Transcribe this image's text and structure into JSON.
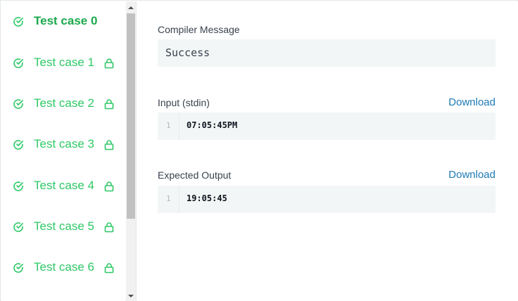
{
  "test_cases": [
    {
      "label": "Test case 0",
      "status": "passed",
      "locked": false,
      "active": true
    },
    {
      "label": "Test case 1",
      "status": "passed",
      "locked": true,
      "active": false
    },
    {
      "label": "Test case 2",
      "status": "passed",
      "locked": true,
      "active": false
    },
    {
      "label": "Test case 3",
      "status": "passed",
      "locked": true,
      "active": false
    },
    {
      "label": "Test case 4",
      "status": "passed",
      "locked": true,
      "active": false
    },
    {
      "label": "Test case 5",
      "status": "passed",
      "locked": true,
      "active": false
    },
    {
      "label": "Test case 6",
      "status": "passed",
      "locked": true,
      "active": false
    }
  ],
  "icons": {
    "status": "check-circle-icon",
    "locked": "lock-icon",
    "scroll_up": "scroll-up-arrow-icon",
    "scroll_down": "scroll-down-arrow-icon"
  },
  "colors": {
    "success_green": "#2ec866",
    "link_blue": "#1c7ab5",
    "box_bg": "#f3f6f6"
  },
  "compiler": {
    "label": "Compiler Message",
    "message": "Success"
  },
  "input": {
    "label": "Input (stdin)",
    "download_label": "Download",
    "lines": [
      {
        "num": "1",
        "text": "07:05:45PM"
      }
    ]
  },
  "expected": {
    "label": "Expected Output",
    "download_label": "Download",
    "lines": [
      {
        "num": "1",
        "text": "19:05:45"
      }
    ]
  }
}
